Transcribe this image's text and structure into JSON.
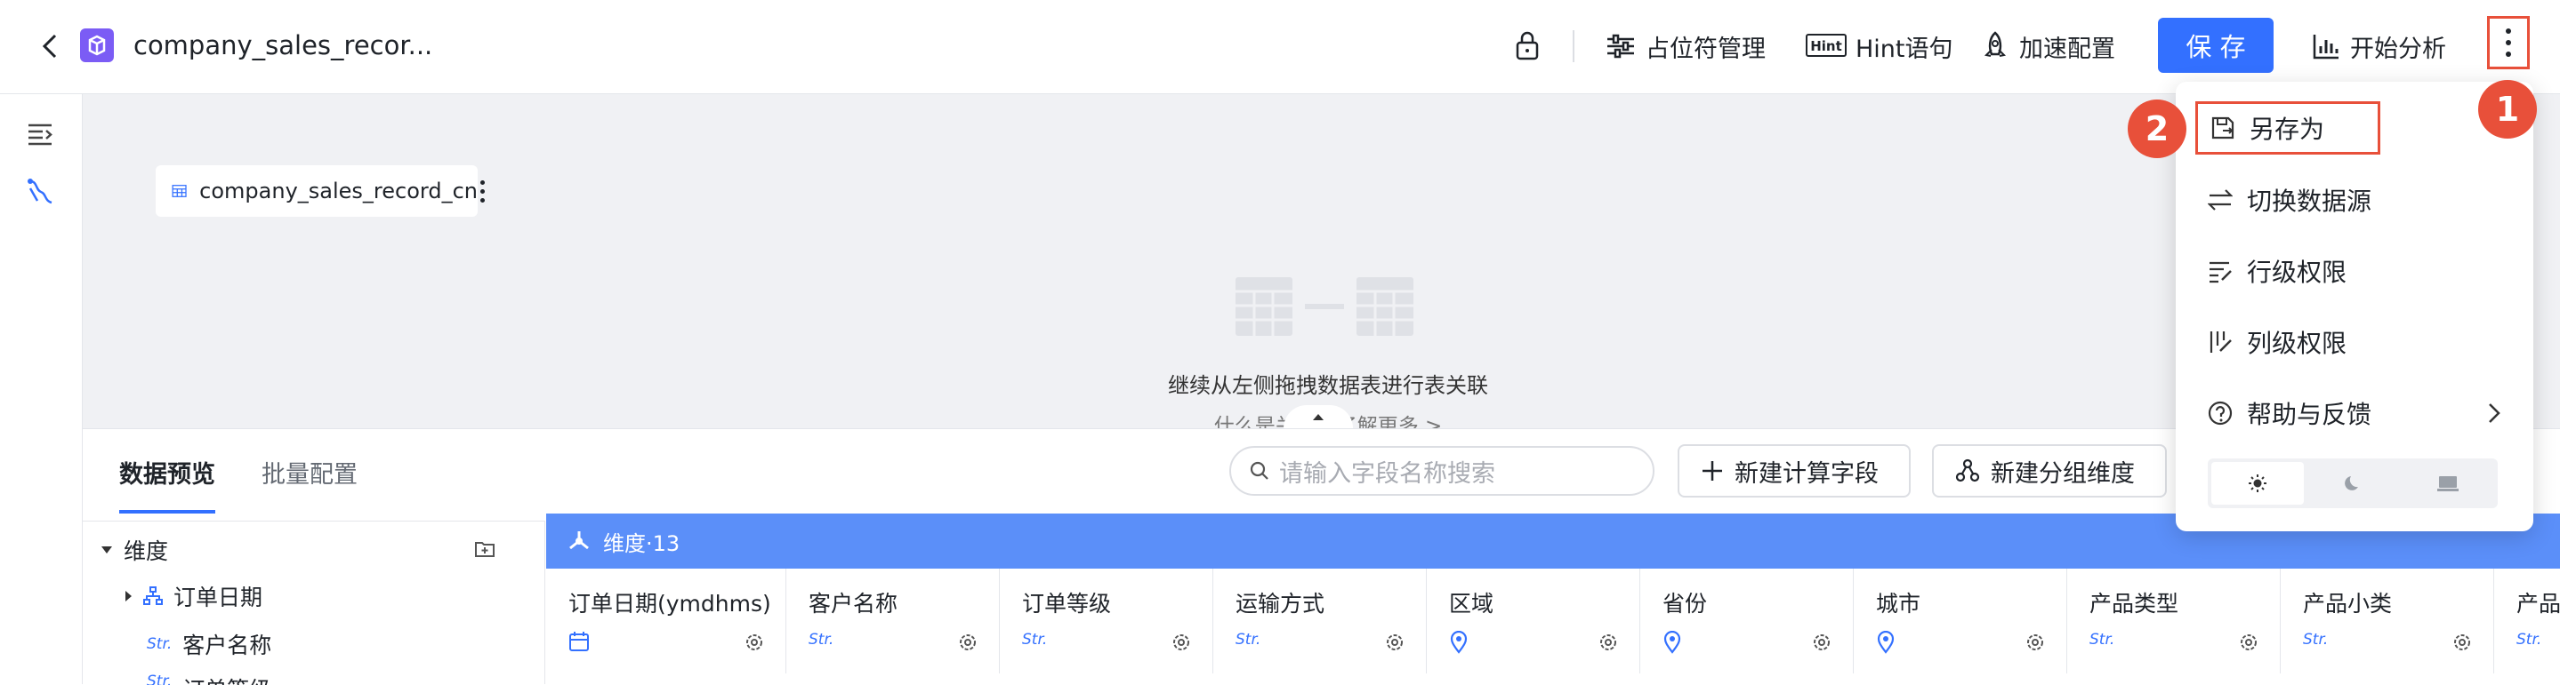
{
  "header": {
    "title": "company_sales_recor...",
    "placeholder_mgmt": "占位符管理",
    "hint_label": "Hint语句",
    "speed_label": "加速配置",
    "save_label": "保 存",
    "analyze_label": "开始分析"
  },
  "canvas": {
    "table_chip": "company_sales_record_cn",
    "hint_line1": "继续从左侧拖拽数据表进行表关联",
    "hint_line2": "什么是关联，了解更多 >"
  },
  "panel": {
    "tabs": [
      "数据预览",
      "批量配置"
    ],
    "search_placeholder": "请输入字段名称搜索",
    "new_calc_field": "新建计算字段",
    "new_group_dim": "新建分组维度",
    "tree": {
      "header": "维度",
      "items": [
        "订单日期",
        "客户名称",
        "订单等级"
      ],
      "str_tag": "Str."
    },
    "dim_bar_label": "维度·13",
    "columns": [
      {
        "name": "订单日期(ymdhms)",
        "type": "date"
      },
      {
        "name": "客户名称",
        "type": "Str."
      },
      {
        "name": "订单等级",
        "type": "Str."
      },
      {
        "name": "运输方式",
        "type": "Str."
      },
      {
        "name": "区域",
        "type": "geo"
      },
      {
        "name": "省份",
        "type": "geo"
      },
      {
        "name": "城市",
        "type": "geo"
      },
      {
        "name": "产品类型",
        "type": "Str."
      },
      {
        "name": "产品小类",
        "type": "Str."
      },
      {
        "name": "产品",
        "type": "Str."
      }
    ]
  },
  "menu": {
    "items": [
      "另存为",
      "切换数据源",
      "行级权限",
      "列级权限",
      "帮助与反馈"
    ],
    "themes": [
      "light",
      "dark",
      "system"
    ]
  },
  "annotations": {
    "badge1": "1",
    "badge2": "2",
    "accent": "#e8503a"
  },
  "colors": {
    "primary": "#3370ff",
    "dim_bar": "#5b8ff9"
  }
}
